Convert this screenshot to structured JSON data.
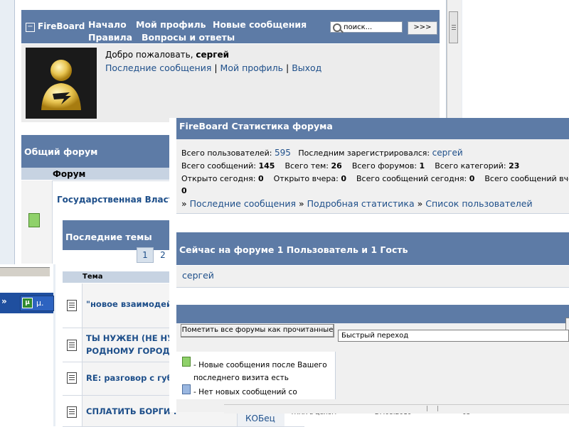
{
  "header": {
    "logo_text": "FireBoard",
    "nav": [
      "Начало",
      "Мой профиль",
      "Новые сообщения",
      "Правила",
      "Вопросы и ответы"
    ],
    "search_placeholder": "поиск...",
    "search_button": ">>>"
  },
  "user": {
    "welcome_prefix": "Добро пожаловать, ",
    "username": "сергей",
    "links": [
      "Последние сообщения",
      "Мой профиль",
      "Выход"
    ],
    "link_separator": "|"
  },
  "general_forum": {
    "title": "Общий форум",
    "header_label": "Форум",
    "forum_name": "Государственная Власт"
  },
  "taskbar": {
    "arrows": "»",
    "app_icon": "µ",
    "app_label": "µ."
  },
  "recent_topics": {
    "title": "Последние темы",
    "pages": [
      "1",
      "2"
    ],
    "header_label": "Тема",
    "topics": [
      {
        "title_lines": [
          "\"новое взаимодей"
        ]
      },
      {
        "title_lines": [
          "ТЫ НУЖЕН (НЕ НУ",
          "РОДНОМУ ГОРОДУ"
        ]
      },
      {
        "title_lines": [
          "RE: разговор с губ"
        ]
      },
      {
        "title_lines": [
          "СПЛАТИТЬ БОРГИ !"
        ]
      }
    ],
    "last_row": {
      "author": "КОБец",
      "forum": "ЖКХ в целом",
      "date": "27.08.2010",
      "count": "05"
    }
  },
  "stats": {
    "title": "FireBoard Статистика форума",
    "total_users_label": "Всего пользователей:",
    "total_users": "595",
    "last_registered_label": "Последним зарегистрировался:",
    "last_registered": "сергей",
    "total_posts_label": "Всего сообщений:",
    "total_posts": "145",
    "total_topics_label": "Всего тем:",
    "total_topics": "26",
    "total_forums_label": "Всего форумов:",
    "total_forums": "1",
    "total_categories_label": "Всего категорий:",
    "total_categories": "23",
    "opened_today_label": "Открыто сегодня:",
    "opened_today": "0",
    "opened_yesterday_label": "Открыто вчера:",
    "opened_yesterday": "0",
    "posts_today_label": "Всего сообщений сегодня:",
    "posts_today": "0",
    "posts_yesterday_label": "Всего сообщений вче",
    "posts_yesterday": "0",
    "links_prefix": "»",
    "links": [
      "Последние сообщения",
      "Подробная статистика",
      "Список пользователей"
    ]
  },
  "online": {
    "title": "Сейчас на форуме 1 Пользователь и 1 Гость",
    "user": "сергей"
  },
  "actions": {
    "mark_read": "Пометить все форумы как прочитанные",
    "quick_jump": "Быстрый переход"
  },
  "legend": {
    "new_posts": "- Новые сообщения после Вашего последнего визита есть",
    "no_new_posts": "- Нет новых сообщений со"
  },
  "colors": {
    "header_blue": "#5d7ba6",
    "link": "#1e4f8a",
    "new_icon_green": "#8fd16a",
    "old_icon_blue": "#9ab7e0"
  }
}
